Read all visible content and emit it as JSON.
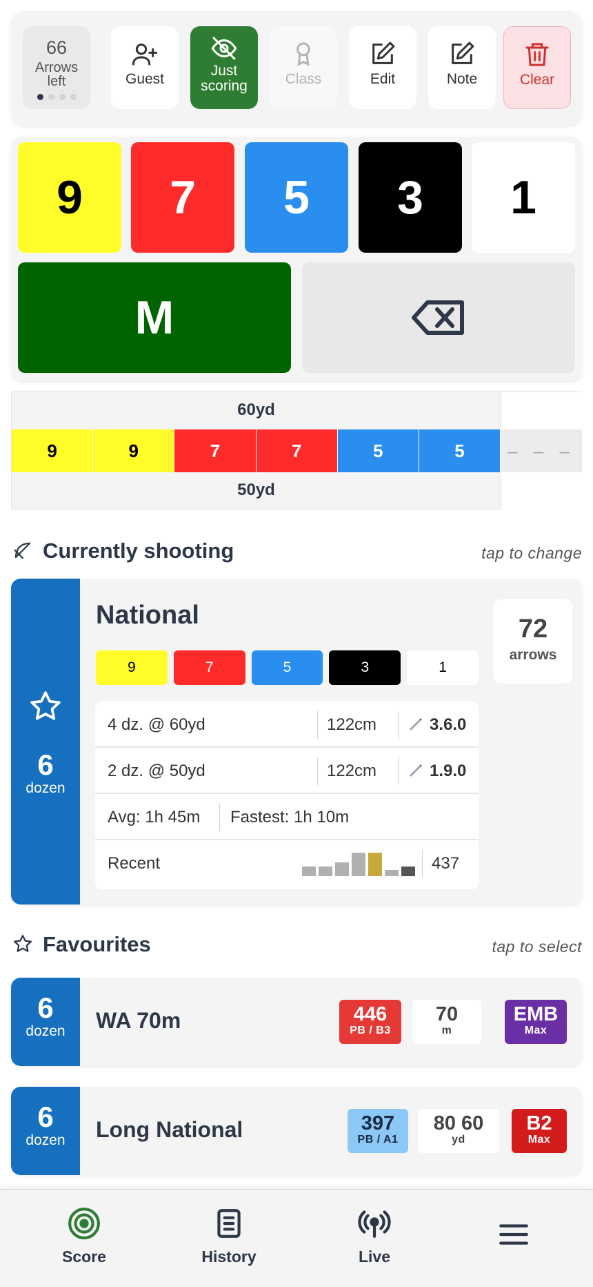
{
  "toolbar": {
    "arrows_left": {
      "count": "66",
      "label": "Arrows left"
    },
    "buttons": {
      "guest": "Guest",
      "just_scoring": "Just scoring",
      "class": "Class",
      "edit": "Edit",
      "note": "Note",
      "clear": "Clear"
    }
  },
  "keypad": {
    "keys": [
      {
        "label": "9",
        "bg": "#fffc2a",
        "fg": "#000000"
      },
      {
        "label": "7",
        "bg": "#ff2a2a",
        "fg": "#ffffff"
      },
      {
        "label": "5",
        "bg": "#2a8eef",
        "fg": "#ffffff"
      },
      {
        "label": "3",
        "bg": "#000000",
        "fg": "#ffffff"
      },
      {
        "label": "1",
        "bg": "#ffffff",
        "fg": "#000000"
      }
    ],
    "miss": {
      "label": "M",
      "bg": "#006400"
    },
    "backspace_icon": "backspace-icon"
  },
  "end": {
    "distance_top": "60yd",
    "distance_bottom": "50yd",
    "arrows": [
      {
        "value": "9",
        "bg": "#fffc2a",
        "fg": "#000000"
      },
      {
        "value": "9",
        "bg": "#fffc2a",
        "fg": "#000000"
      },
      {
        "value": "7",
        "bg": "#ff2a2a",
        "fg": "#ffffff"
      },
      {
        "value": "7",
        "bg": "#ff2a2a",
        "fg": "#ffffff"
      },
      {
        "value": "5",
        "bg": "#2a8eef",
        "fg": "#ffffff"
      },
      {
        "value": "5",
        "bg": "#2a8eef",
        "fg": "#ffffff"
      }
    ],
    "placeholder": "– – –"
  },
  "current": {
    "section_title": "Currently shooting",
    "hint": "tap to change",
    "dozen": "6",
    "dozen_label": "dozen",
    "round_name": "National",
    "arrows": "72",
    "arrows_label": "arrows",
    "zones": [
      {
        "label": "9",
        "bg": "#fffc2a",
        "fg": "#000000"
      },
      {
        "label": "7",
        "bg": "#ff2a2a",
        "fg": "#ffffff"
      },
      {
        "label": "5",
        "bg": "#2a8eef",
        "fg": "#ffffff"
      },
      {
        "label": "3",
        "bg": "#000000",
        "fg": "#ffffff"
      },
      {
        "label": "1",
        "bg": "#ffffff",
        "fg": "#000000"
      }
    ],
    "rows": [
      {
        "dist": "4 dz. @ 60yd",
        "face": "122cm",
        "sight": "3.6.0"
      },
      {
        "dist": "2 dz. @ 50yd",
        "face": "122cm",
        "sight": "1.9.0"
      }
    ],
    "avg": "Avg: 1h 45m",
    "fastest": "Fastest: 1h 10m",
    "recent_label": "Recent",
    "recent_scores": [
      0.4,
      0.4,
      0.55,
      0.95,
      0.95,
      0.25,
      0.4
    ],
    "recent_colors": [
      "#b0b0b0",
      "#b0b0b0",
      "#b0b0b0",
      "#b0b0b0",
      "#c8a83a",
      "#b0b0b0",
      "#555555"
    ],
    "recent_value": "437"
  },
  "favourites": {
    "section_title": "Favourites",
    "hint": "tap to select",
    "items": [
      {
        "dozen": "6",
        "dozen_label": "dozen",
        "name": "WA 70m",
        "pb": {
          "big": "446",
          "small": "PB / B3",
          "bg": "#e53935",
          "fg": "#ffffff"
        },
        "dist": {
          "big": "70",
          "small": "m"
        },
        "cls": {
          "big": "EMB",
          "small": "Max",
          "bg": "#6a2fa5",
          "fg": "#ffffff"
        }
      },
      {
        "dozen": "6",
        "dozen_label": "dozen",
        "name": "Long National",
        "pb": {
          "big": "397",
          "small": "PB / A1",
          "bg": "#8cc8f5",
          "fg": "#1a2a44"
        },
        "dist": {
          "big": "80 60",
          "small": "yd"
        },
        "cls": {
          "big": "B2",
          "small": "Max",
          "bg": "#d41b1b",
          "fg": "#ffffff"
        }
      }
    ]
  },
  "nav": {
    "score": "Score",
    "history": "History",
    "live": "Live"
  },
  "colors": {
    "accent_blue": "#1670bf",
    "just_scoring_green": "#2e7d32",
    "clear_red": "#d32f2f"
  }
}
